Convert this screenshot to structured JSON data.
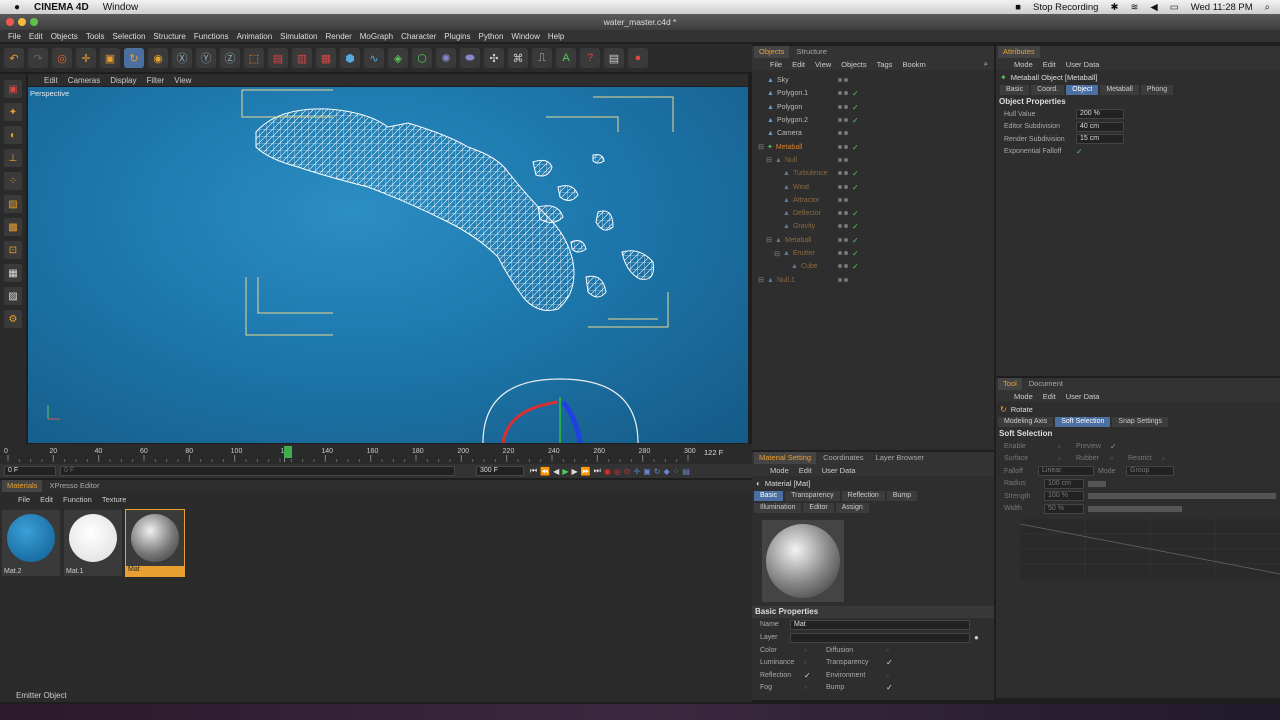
{
  "mac_menu": {
    "apple": "",
    "app": "CINEMA 4D",
    "window": "Window",
    "stop_recording": "Stop Recording",
    "clock": "Wed 11:28 PM"
  },
  "window_title": "water_master.c4d *",
  "menu": [
    "File",
    "Edit",
    "Objects",
    "Tools",
    "Selection",
    "Structure",
    "Functions",
    "Animation",
    "Simulation",
    "Render",
    "MoGraph",
    "Character",
    "Plugins",
    "Python",
    "Window",
    "Help"
  ],
  "viewport": {
    "menu": [
      "Edit",
      "Cameras",
      "Display",
      "Filter",
      "View"
    ],
    "label": "Perspective"
  },
  "timeline": {
    "ticks": [
      "0",
      "20",
      "40",
      "60",
      "80",
      "100",
      "122",
      "140",
      "160",
      "180",
      "200",
      "220",
      "240",
      "260",
      "280",
      "300"
    ],
    "current": "122 F",
    "start": "0 F",
    "field1": "0 F",
    "field2": "300 F",
    "field3": "300 F"
  },
  "materials": {
    "tabs": [
      "Materials",
      "XPresso Editor"
    ],
    "menu": [
      "File",
      "Edit",
      "Function",
      "Texture"
    ],
    "items": [
      {
        "name": "Mat.2",
        "kind": "blue"
      },
      {
        "name": "Mat.1",
        "kind": "white"
      },
      {
        "name": "Mat",
        "kind": "chrome"
      }
    ]
  },
  "status": "Emitter Object",
  "objects": {
    "tabs": [
      "Objects",
      "Structure"
    ],
    "menu": [
      "File",
      "Edit",
      "View",
      "Objects",
      "Tags",
      "Bookm"
    ],
    "rows": [
      {
        "name": "Sky",
        "indent": 0,
        "style": "normal",
        "check": false
      },
      {
        "name": "Polygon.1",
        "indent": 0,
        "style": "normal",
        "check": true
      },
      {
        "name": "Polygon",
        "indent": 0,
        "style": "normal",
        "check": true
      },
      {
        "name": "Polygon.2",
        "indent": 0,
        "style": "normal",
        "check": true
      },
      {
        "name": "Camera",
        "indent": 0,
        "style": "normal",
        "check": false
      },
      {
        "name": "Metaball",
        "indent": 0,
        "style": "orange",
        "check": true
      },
      {
        "name": "Null",
        "indent": 1,
        "style": "dim",
        "check": false
      },
      {
        "name": "Turbulence",
        "indent": 2,
        "style": "dim",
        "check": true
      },
      {
        "name": "Wind",
        "indent": 2,
        "style": "dim",
        "check": true
      },
      {
        "name": "Attractor",
        "indent": 2,
        "style": "dim",
        "check": false
      },
      {
        "name": "Deflector",
        "indent": 2,
        "style": "dim",
        "check": true
      },
      {
        "name": "Gravity",
        "indent": 2,
        "style": "dim",
        "check": true
      },
      {
        "name": "Metaball",
        "indent": 1,
        "style": "dim",
        "check": true
      },
      {
        "name": "Emitter",
        "indent": 2,
        "style": "dim",
        "check": true
      },
      {
        "name": "Cube",
        "indent": 3,
        "style": "dim",
        "check": true
      },
      {
        "name": "Null.1",
        "indent": 0,
        "style": "dim",
        "check": false
      }
    ]
  },
  "attributes": {
    "tabs": [
      "Attributes"
    ],
    "menu": [
      "Mode",
      "Edit",
      "User Data"
    ],
    "title": "Metaball Object [Metaball]",
    "subtabs": [
      "Basic",
      "Coord.",
      "Object",
      "Metaball",
      "Phong"
    ],
    "section": "Object Properties",
    "props": [
      {
        "label": "Hull Value",
        "value": "200 %"
      },
      {
        "label": "Editor Subdivision",
        "value": "40 cm"
      },
      {
        "label": "Render Subdivision",
        "value": "15 cm"
      },
      {
        "label": "Exponential Falloff",
        "value": "✓"
      }
    ]
  },
  "tool": {
    "tabs": [
      "Tool",
      "Document"
    ],
    "menu": [
      "Mode",
      "Edit",
      "User Data"
    ],
    "title": "Rotate",
    "subtabs": [
      "Modeling Axis",
      "Soft Selection",
      "Snap Settings"
    ],
    "section": "Soft Selection",
    "row1": [
      "Enable",
      "Preview"
    ],
    "row2": [
      "Surface",
      "Rubber",
      "Restrict"
    ],
    "falloff_label": "Falloff",
    "falloff_value": "Linear",
    "mode_label": "Mode",
    "mode_value": "Group",
    "radius_label": "Radius",
    "radius_value": "100 cm",
    "strength_label": "Strength",
    "strength_value": "100 %",
    "width_label": "Width",
    "width_value": "50 %"
  },
  "matset": {
    "tabs": [
      "Material Setting",
      "Coordinates",
      "Layer Browser"
    ],
    "menu": [
      "Mode",
      "Edit",
      "User Data"
    ],
    "title": "Material [Mat]",
    "subtabs1": [
      "Basic",
      "Transparency",
      "Reflection",
      "Bump"
    ],
    "subtabs2": [
      "Illumination",
      "Editor",
      "Assign"
    ],
    "section": "Basic Properties",
    "name_label": "Name",
    "name_value": "Mat",
    "layer_label": "Layer",
    "channels": [
      {
        "left": "Color",
        "lchk": false,
        "right": "Diffusion",
        "rchk": false
      },
      {
        "left": "Luminance",
        "lchk": false,
        "right": "Transparency",
        "rchk": true
      },
      {
        "left": "Reflection",
        "lchk": true,
        "right": "Environment",
        "rchk": false
      },
      {
        "left": "Fog",
        "lchk": false,
        "right": "Bump",
        "rchk": true
      }
    ]
  },
  "colors": {
    "accent": "#e8a030",
    "viewport": "#1d77ac",
    "selected": "#4a6fa0"
  }
}
